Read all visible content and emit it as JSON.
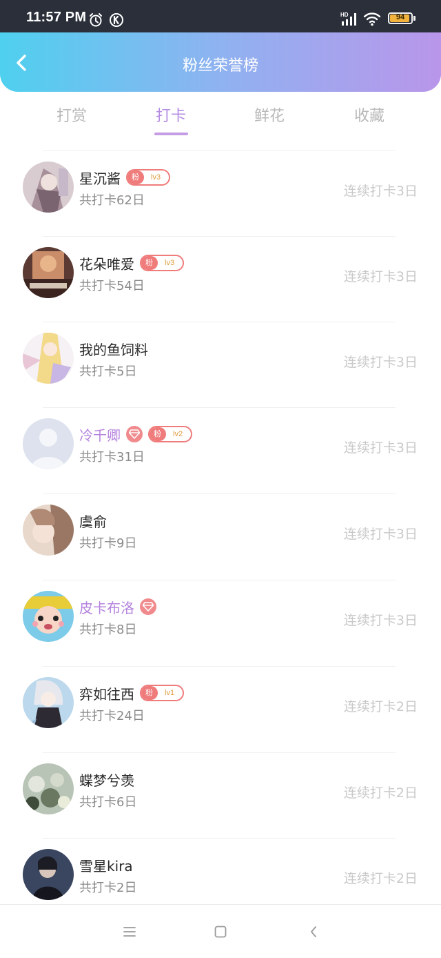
{
  "status_bar": {
    "time": "11:57 PM",
    "battery_level": "94",
    "battery_fraction": 0.94,
    "icons": [
      "alarm-icon",
      "k-app-icon",
      "hd-signal-icon",
      "wifi-icon",
      "battery-icon"
    ]
  },
  "header": {
    "title": "粉丝荣誉榜",
    "back_icon": "chevron-left-icon",
    "gradient_colors": [
      "#4fd0ef",
      "#b996ea"
    ]
  },
  "tabs": [
    {
      "label": "打赏",
      "active": false
    },
    {
      "label": "打卡",
      "active": true
    },
    {
      "label": "鲜花",
      "active": false
    },
    {
      "label": "收藏",
      "active": false
    }
  ],
  "colors": {
    "accent": "#b58ee4",
    "fan_badge": "#ef7b7b",
    "level_text": "#e09a3a",
    "vip_name": "#b583de"
  },
  "list": [
    {
      "name": "星沉酱",
      "total": "共打卡62日",
      "streak": "连续打卡3日",
      "vip": false,
      "fan_label": "粉",
      "level": "lv3"
    },
    {
      "name": "花朵唯爱",
      "total": "共打卡54日",
      "streak": "连续打卡3日",
      "vip": false,
      "fan_label": "粉",
      "level": "lv3"
    },
    {
      "name": "我的鱼饲料",
      "total": "共打卡5日",
      "streak": "连续打卡3日",
      "vip": false
    },
    {
      "name": "冷千卿",
      "total": "共打卡31日",
      "streak": "连续打卡3日",
      "vip": true,
      "fan_label": "粉",
      "level": "lv2"
    },
    {
      "name": "虞俞",
      "total": "共打卡9日",
      "streak": "连续打卡3日",
      "vip": false
    },
    {
      "name": "皮卡布洛",
      "total": "共打卡8日",
      "streak": "连续打卡3日",
      "vip": true
    },
    {
      "name": "弈如往西",
      "total": "共打卡24日",
      "streak": "连续打卡2日",
      "vip": false,
      "fan_label": "粉",
      "level": "lv1"
    },
    {
      "name": "蝶梦兮羡",
      "total": "共打卡6日",
      "streak": "连续打卡2日",
      "vip": false
    },
    {
      "name": "雪星kira",
      "total": "共打卡2日",
      "streak": "连续打卡2日",
      "vip": false
    }
  ],
  "nav_bar": {
    "buttons": [
      "menu-icon",
      "home-square-icon",
      "back-triangle-icon"
    ]
  }
}
